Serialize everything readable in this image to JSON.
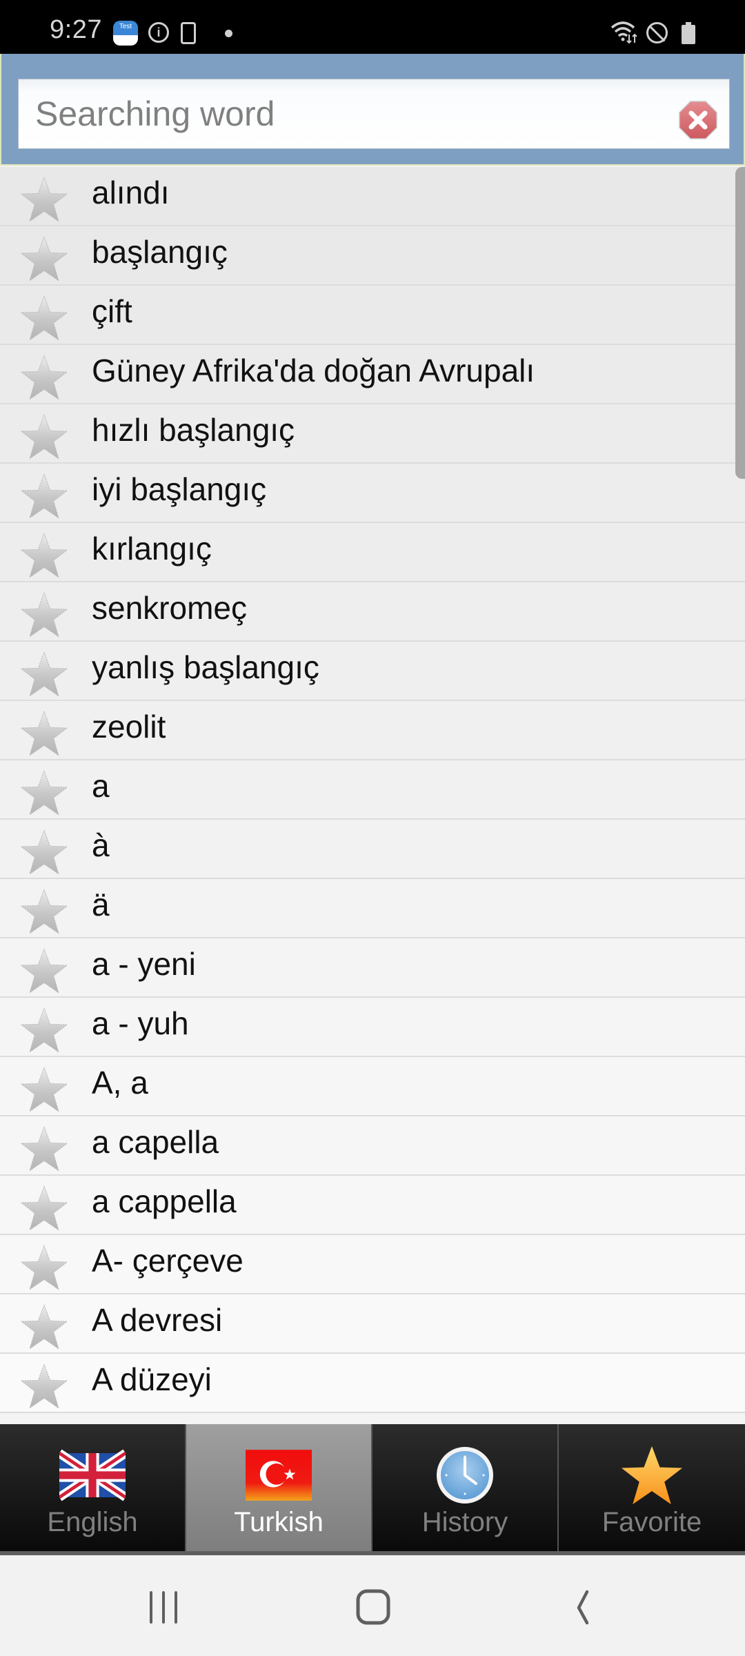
{
  "status_bar": {
    "time": "9:27",
    "notification_icons": [
      "test-app-icon",
      "info-icon",
      "phone-check-icon",
      "dot-icon"
    ],
    "system_icons": [
      "wifi-icon",
      "do-not-disturb-icon",
      "battery-icon"
    ],
    "test_app_label": "Test"
  },
  "search": {
    "placeholder": "Searching word",
    "value": "",
    "clear_icon": "clear-icon",
    "clear_color": "#d9666b"
  },
  "word_list": {
    "items": [
      {
        "word": "alındı",
        "favorite": false
      },
      {
        "word": "başlangıç",
        "favorite": false
      },
      {
        "word": "çift",
        "favorite": false
      },
      {
        "word": "Güney Afrika'da doğan Avrupalı",
        "favorite": false
      },
      {
        "word": "hızlı başlangıç",
        "favorite": false
      },
      {
        "word": "iyi başlangıç",
        "favorite": false
      },
      {
        "word": "kırlangıç",
        "favorite": false
      },
      {
        "word": "senkromeç",
        "favorite": false
      },
      {
        "word": "yanlış başlangıç",
        "favorite": false
      },
      {
        "word": "zeolit",
        "favorite": false
      },
      {
        "word": "a",
        "favorite": false
      },
      {
        "word": "à",
        "favorite": false
      },
      {
        "word": "ä",
        "favorite": false
      },
      {
        "word": "a - yeni",
        "favorite": false
      },
      {
        "word": "a - yuh",
        "favorite": false
      },
      {
        "word": "A, a",
        "favorite": false
      },
      {
        "word": "a capella",
        "favorite": false
      },
      {
        "word": "a cappella",
        "favorite": false
      },
      {
        "word": "A- çerçeve",
        "favorite": false
      },
      {
        "word": "A devresi",
        "favorite": false
      },
      {
        "word": "A düzeyi",
        "favorite": false
      }
    ]
  },
  "tabs": [
    {
      "label": "English",
      "icon": "uk-flag-icon",
      "active": false
    },
    {
      "label": "Turkish",
      "icon": "turkey-flag-icon",
      "active": true
    },
    {
      "label": "History",
      "icon": "clock-icon",
      "active": false
    },
    {
      "label": "Favorite",
      "icon": "star-icon",
      "active": false
    }
  ],
  "nav_bar": {
    "buttons": [
      "recents-icon",
      "home-icon",
      "back-icon"
    ]
  },
  "colors": {
    "search_panel": "#7f9fc2",
    "active_tab": "#8f8f8f",
    "inactive_tab": "#1a1a1a",
    "favorite_star": "#f9a21c",
    "list_background": "#f4f4f4"
  }
}
